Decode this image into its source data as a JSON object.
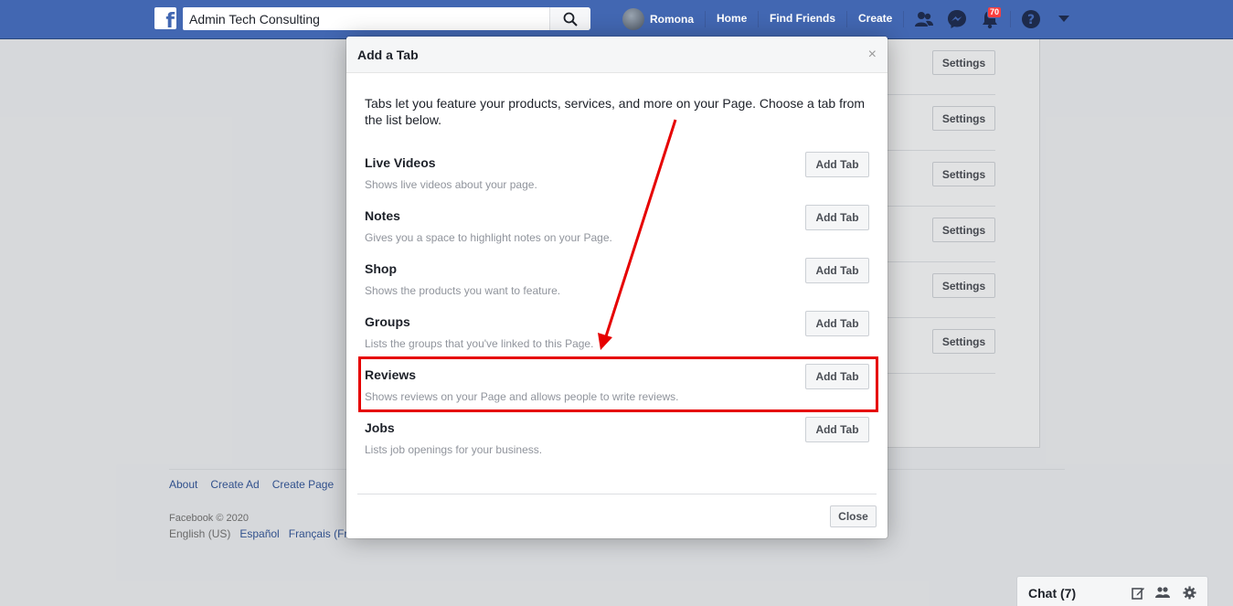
{
  "topbar": {
    "logo": "f",
    "search_value": "Admin Tech Consulting",
    "user_name": "Romona",
    "links": [
      "Home",
      "Find Friends",
      "Create"
    ],
    "notifications_count": "70",
    "icons": [
      "friend-requests-icon",
      "messenger-icon",
      "notifications-icon",
      "help-icon",
      "account-menu-icon"
    ]
  },
  "background": {
    "settings_label": "Settings",
    "footer_links": [
      "About",
      "Create Ad",
      "Create Page"
    ],
    "copyright": "Facebook © 2020",
    "languages": [
      "English (US)",
      "Español",
      "Français (Fr"
    ]
  },
  "modal": {
    "title": "Add a Tab",
    "close_symbol": "×",
    "intro": "Tabs let you feature your products, services, and more on your Page. Choose a tab from the list below.",
    "add_label": "Add Tab",
    "tabs": [
      {
        "name": "Live Videos",
        "desc": "Shows live videos about your page."
      },
      {
        "name": "Notes",
        "desc": "Gives you a space to highlight notes on your Page."
      },
      {
        "name": "Shop",
        "desc": "Shows the products you want to feature."
      },
      {
        "name": "Groups",
        "desc": "Lists the groups that you've linked to this Page."
      },
      {
        "name": "Reviews",
        "desc": "Shows reviews on your Page and allows people to write reviews."
      },
      {
        "name": "Jobs",
        "desc": "Lists job openings for your business."
      }
    ],
    "close_label": "Close"
  },
  "annotation": {
    "highlight_color": "#e60000"
  },
  "chat": {
    "label": "Chat (7)",
    "icons": [
      "new-message-icon",
      "group-chat-icon",
      "chat-settings-icon"
    ]
  },
  "colors": {
    "brand_blue": "#4267b2",
    "badge_red": "#fa3e3e"
  }
}
